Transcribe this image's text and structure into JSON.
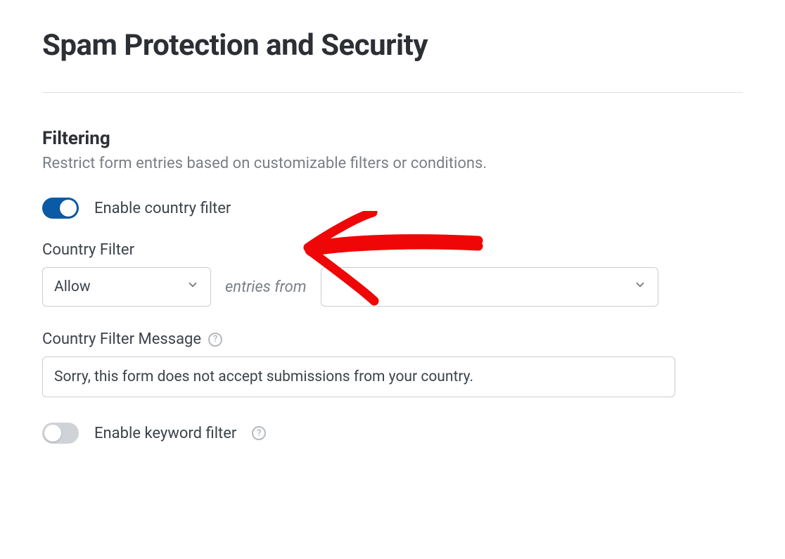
{
  "page": {
    "title": "Spam Protection and Security"
  },
  "filtering": {
    "section_title": "Filtering",
    "section_desc": "Restrict form entries based on customizable filters or conditions.",
    "country_toggle_label": "Enable country filter",
    "country_toggle_on": true,
    "country_filter_label": "Country Filter",
    "country_action_value": "Allow",
    "entries_from_text": "entries from",
    "country_select_value": "",
    "message_label": "Country Filter Message",
    "message_value": "Sorry, this form does not accept submissions from your country.",
    "keyword_toggle_label": "Enable keyword filter",
    "keyword_toggle_on": false
  },
  "colors": {
    "accent": "#0a5aa6",
    "annotation": "#ef0606"
  }
}
